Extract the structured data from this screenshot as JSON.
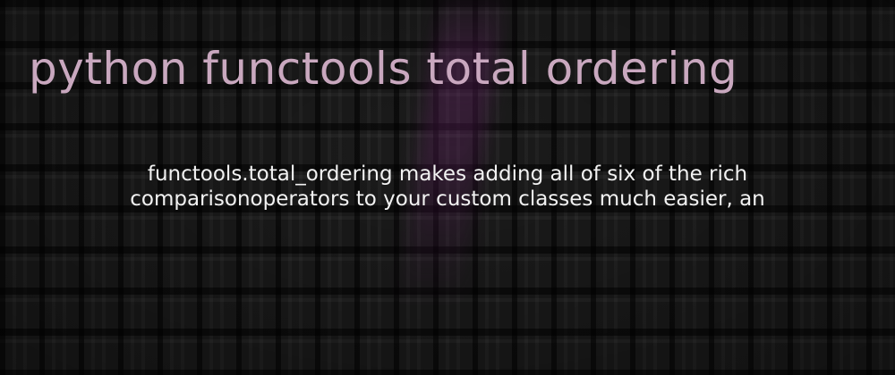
{
  "title": "python functools total ordering",
  "description": {
    "line1": "functools.total_ordering makes adding all of six of the rich",
    "line2": "comparisonoperators to your custom classes much easier, an"
  },
  "colors": {
    "background": "#1b1b1b",
    "title": "#c9a8bf",
    "description": "#f2f2f2",
    "accent_streak": "#782878"
  }
}
